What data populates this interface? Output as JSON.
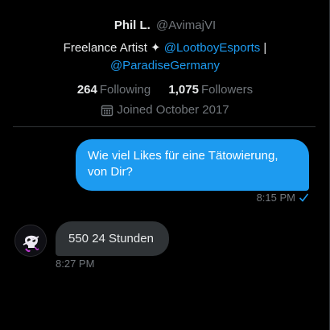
{
  "profile": {
    "display_name": "Phil L.",
    "handle": "@AvimajVI",
    "bio_prefix": "Freelance Artist ✦ ",
    "bio_mention_1": "@LootboyEsports",
    "bio_separator": " |",
    "bio_mention_2": "@ParadiseGermany",
    "following_count": "264",
    "following_label": "Following",
    "followers_count": "1,075",
    "followers_label": "Followers",
    "joined": "Joined October 2017"
  },
  "messages": [
    {
      "direction": "sent",
      "text": "Wie viel Likes für eine Tätowierung, von Dir?",
      "time": "8:15 PM",
      "status_icon": "check-icon"
    },
    {
      "direction": "received",
      "text": "550 24 Stunden",
      "time": "8:27 PM"
    }
  ],
  "colors": {
    "accent": "#1d9bf0",
    "background": "#000000",
    "received_bubble": "#2f3336",
    "secondary_text": "#71767b"
  }
}
